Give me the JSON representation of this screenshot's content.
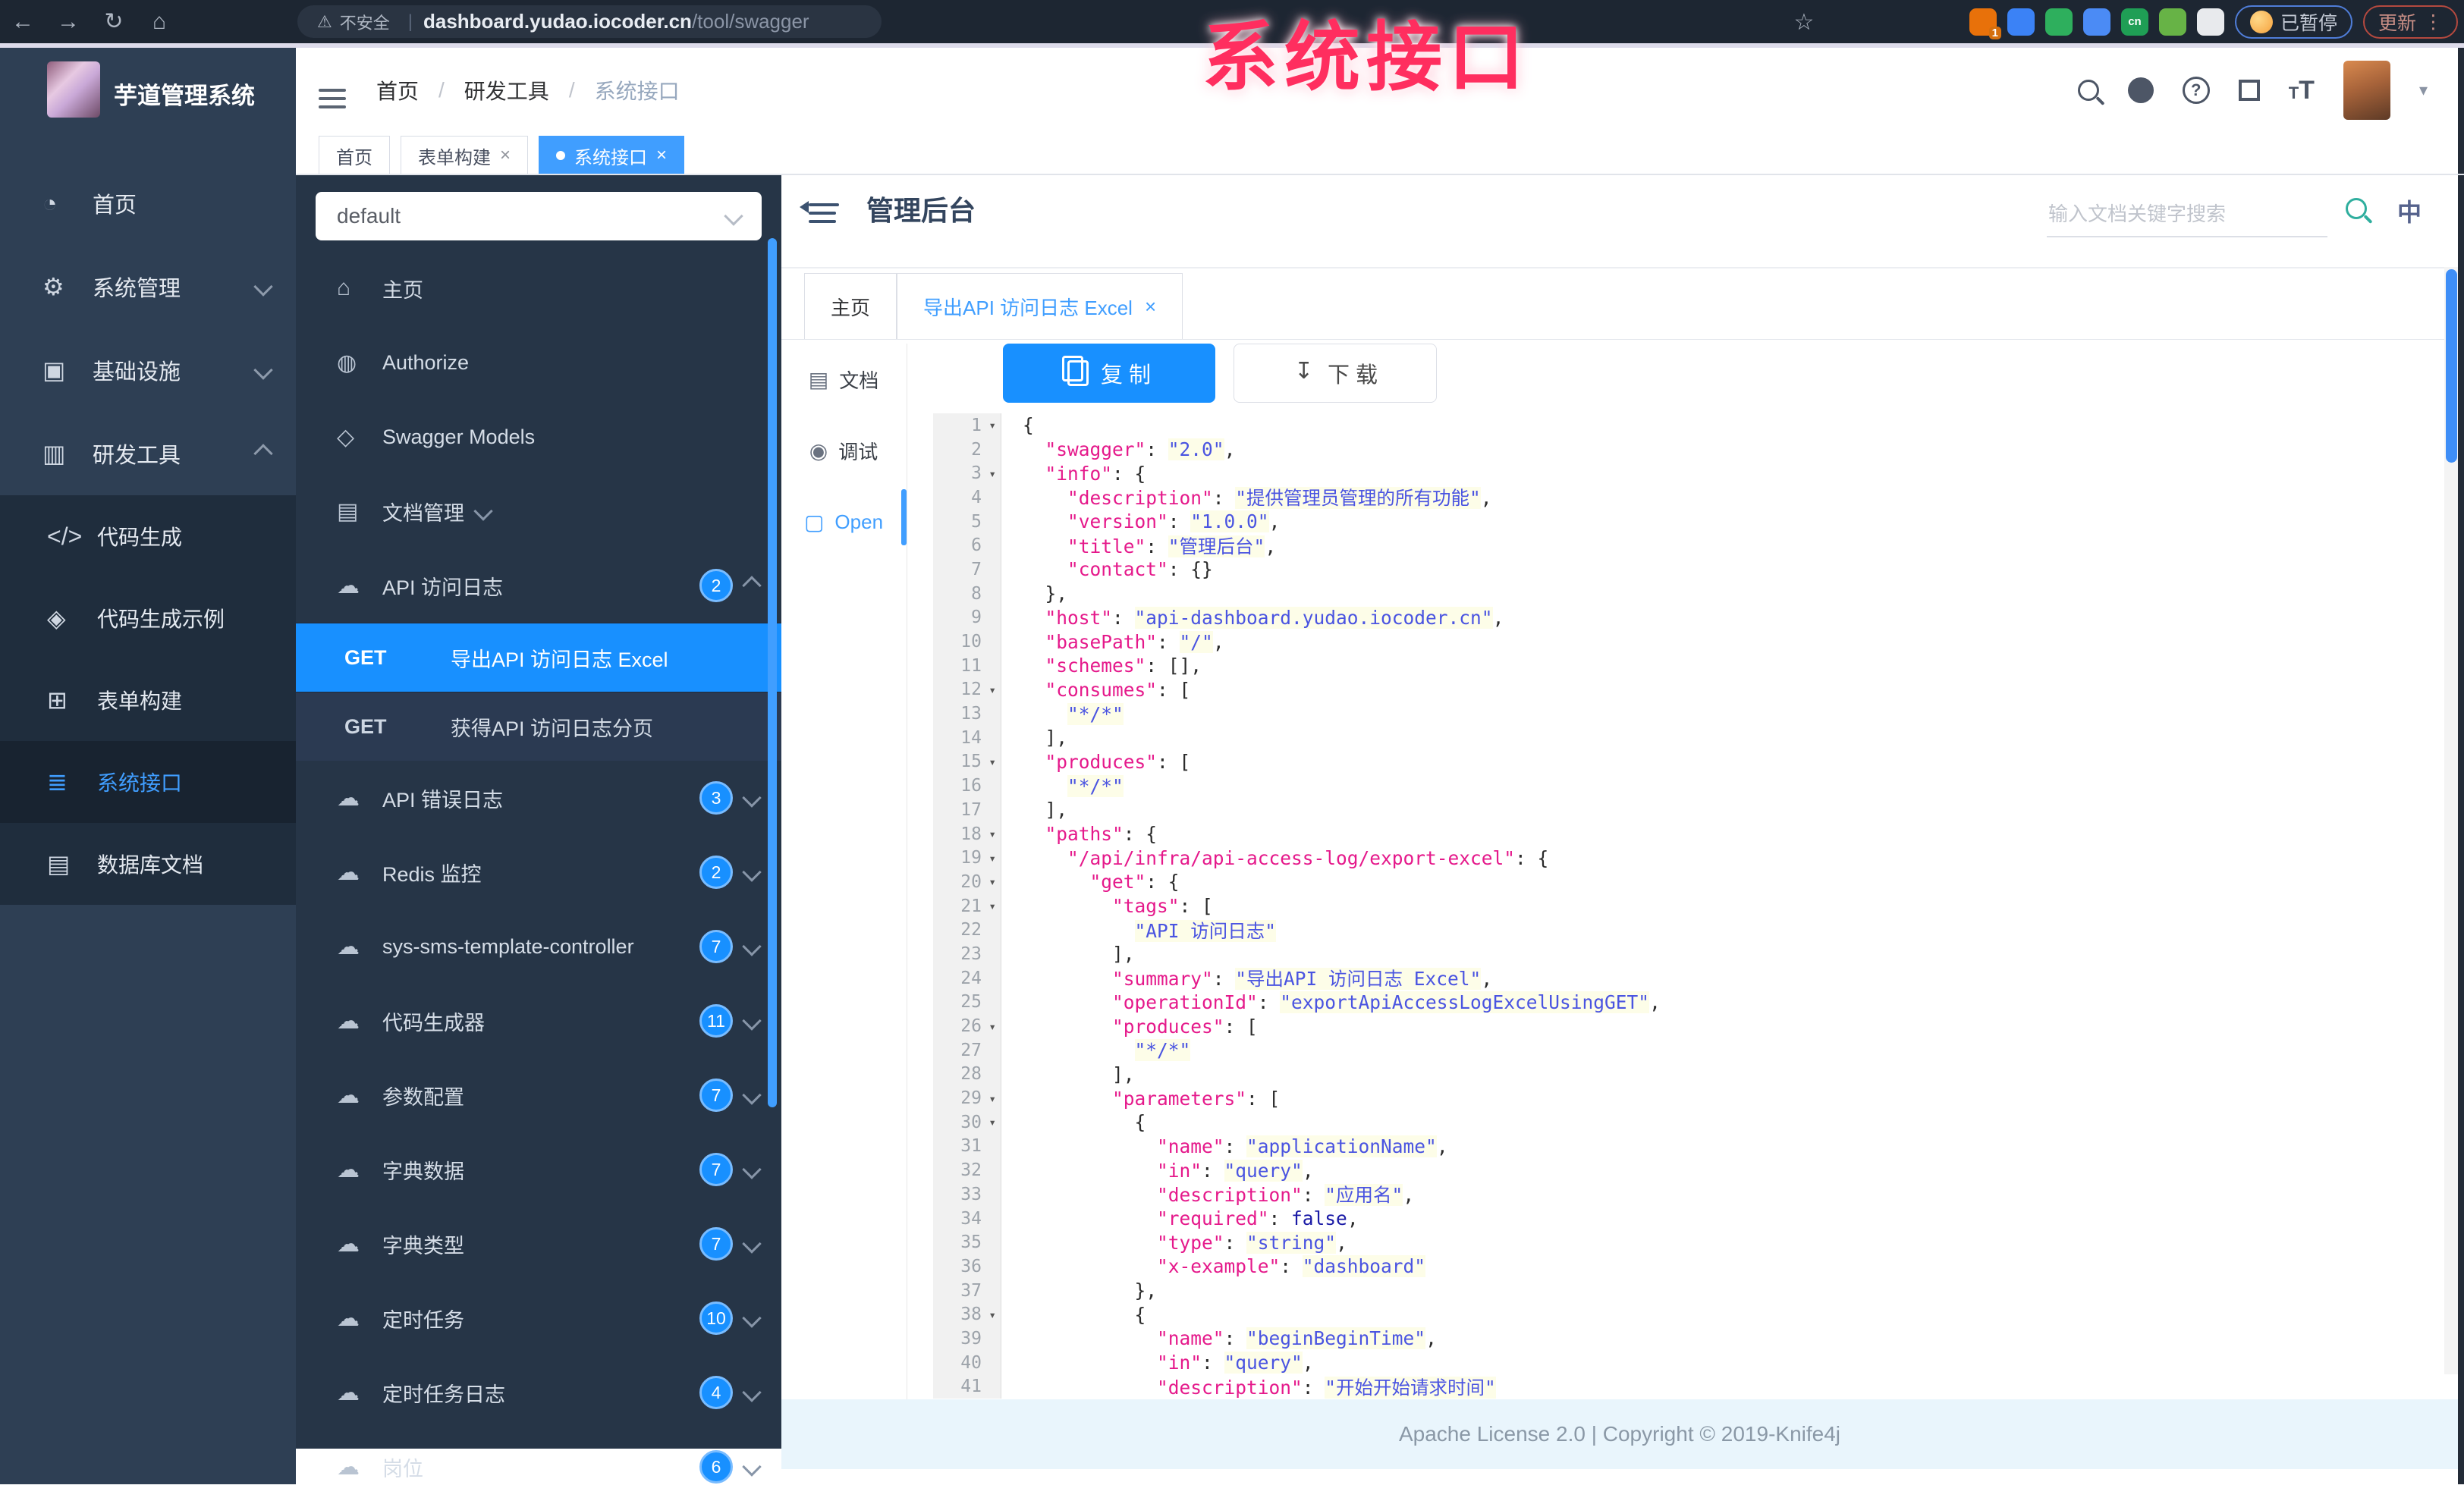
{
  "colors": {
    "accent": "#1890ff",
    "sidebar_bg": "#2e3f54",
    "submenu_bg": "#1f2d3d",
    "panel_bg": "#263547",
    "code_key": "#e5198b",
    "code_string": "#4a54e1",
    "code_bool": "#1a1aa6",
    "footer_bg": "#e9f5fc"
  },
  "annotation": {
    "text": "系统接口"
  },
  "browser": {
    "secure_label": "不安全",
    "url_host": "dashboard.yudao.iocoder.cn",
    "url_path": "/tool/swagger",
    "paused_label": "已暂停",
    "update_label": "更新",
    "extensions": [
      {
        "name": "extension-orange",
        "color": "#e8710a",
        "badge": "1"
      },
      {
        "name": "extension-drop",
        "color": "#3b82f6"
      },
      {
        "name": "extension-shield",
        "color": "#2eaf5d"
      },
      {
        "name": "extension-grid",
        "color": "#4b8bf5"
      },
      {
        "name": "extension-cn",
        "color": "#1f9e55",
        "label": "cn"
      },
      {
        "name": "extension-leaf",
        "color": "#67b346"
      },
      {
        "name": "extension-star",
        "color": "#e8eaed"
      }
    ]
  },
  "sidebar": {
    "logo_title": "芋道管理系统",
    "items": [
      {
        "label": "首页",
        "icon": "dashboard-icon",
        "glyph": "◔"
      },
      {
        "label": "系统管理",
        "icon": "gear-icon",
        "glyph": "⚙",
        "chevron": "down"
      },
      {
        "label": "基础设施",
        "icon": "monitor-icon",
        "glyph": "▣",
        "chevron": "down"
      },
      {
        "label": "研发工具",
        "icon": "toolbox-icon",
        "glyph": "▥",
        "chevron": "up"
      }
    ],
    "submenu": [
      {
        "label": "代码生成",
        "icon": "code-icon",
        "glyph": "</>"
      },
      {
        "label": "代码生成示例",
        "icon": "shield-icon",
        "glyph": "◈"
      },
      {
        "label": "表单构建",
        "icon": "form-icon",
        "glyph": "⊞"
      },
      {
        "label": "系统接口",
        "icon": "api-icon",
        "glyph": "≣",
        "active": true
      },
      {
        "label": "数据库文档",
        "icon": "database-icon",
        "glyph": "▤"
      }
    ]
  },
  "header": {
    "breadcrumb": [
      "首页",
      "研发工具",
      "系统接口"
    ],
    "tags": [
      {
        "label": "首页"
      },
      {
        "label": "表单构建",
        "closable": true
      },
      {
        "label": "系统接口",
        "closable": true,
        "active": true
      }
    ]
  },
  "api_panel": {
    "group_select": "default",
    "menus": [
      {
        "label": "主页",
        "icon": "home-icon",
        "glyph": "⌂"
      },
      {
        "label": "Authorize",
        "icon": "lock-icon",
        "glyph": "◍"
      },
      {
        "label": "Swagger Models",
        "icon": "models-icon",
        "glyph": "◇"
      },
      {
        "label": "文档管理",
        "icon": "doc-manage-icon",
        "glyph": "▤",
        "chevron": "down"
      },
      {
        "label": "API 访问日志",
        "icon": "cloud-icon",
        "glyph": "☁",
        "badge": "2",
        "chevron": "up"
      }
    ],
    "operations": [
      {
        "method": "GET",
        "label": "导出API 访问日志 Excel",
        "selected": true
      },
      {
        "method": "GET",
        "label": "获得API 访问日志分页"
      }
    ],
    "menus2": [
      {
        "label": "API 错误日志",
        "icon": "cloud-icon",
        "glyph": "☁",
        "badge": "3",
        "chevron": "down"
      },
      {
        "label": "Redis 监控",
        "icon": "cloud-icon",
        "glyph": "☁",
        "badge": "2",
        "chevron": "down"
      },
      {
        "label": "sys-sms-template-controller",
        "icon": "cloud-icon",
        "glyph": "☁",
        "badge": "7",
        "chevron": "down"
      },
      {
        "label": "代码生成器",
        "icon": "cloud-icon",
        "glyph": "☁",
        "badge": "11",
        "chevron": "down"
      },
      {
        "label": "参数配置",
        "icon": "cloud-icon",
        "glyph": "☁",
        "badge": "7",
        "chevron": "down"
      },
      {
        "label": "字典数据",
        "icon": "cloud-icon",
        "glyph": "☁",
        "badge": "7",
        "chevron": "down"
      },
      {
        "label": "字典类型",
        "icon": "cloud-icon",
        "glyph": "☁",
        "badge": "7",
        "chevron": "down"
      },
      {
        "label": "定时任务",
        "icon": "cloud-icon",
        "glyph": "☁",
        "badge": "10",
        "chevron": "down"
      },
      {
        "label": "定时任务日志",
        "icon": "cloud-icon",
        "glyph": "☁",
        "badge": "4",
        "chevron": "down"
      },
      {
        "label": "岗位",
        "icon": "cloud-icon",
        "glyph": "☁",
        "badge": "6",
        "chevron": "down"
      }
    ]
  },
  "content": {
    "title": "管理后台",
    "search_placeholder": "输入文档关键字搜索",
    "lang_icon_label": "中",
    "doc_tabs": [
      {
        "label": "主页"
      },
      {
        "label": "导出API 访问日志 Excel",
        "closable": true,
        "active": true
      }
    ],
    "menu": [
      {
        "label": "文档",
        "icon": "doc-icon",
        "glyph": "▤"
      },
      {
        "label": "调试",
        "icon": "debug-icon",
        "glyph": "◉"
      },
      {
        "label": "Open",
        "icon": "file-icon",
        "glyph": "▢",
        "active": true
      }
    ],
    "copy_label": "复 制",
    "download_label": "下 载",
    "footer": "Apache License 2.0 | Copyright © 2019-Knife4j"
  },
  "code": {
    "lines": [
      {
        "n": 1,
        "f": 1,
        "i": 0,
        "t": [
          [
            "p",
            "{"
          ]
        ]
      },
      {
        "n": 2,
        "i": 2,
        "t": [
          [
            "k",
            "\"swagger\""
          ],
          [
            "p",
            ": "
          ],
          [
            "s",
            "\"2.0\""
          ],
          [
            "p",
            ","
          ]
        ]
      },
      {
        "n": 3,
        "f": 1,
        "i": 2,
        "t": [
          [
            "k",
            "\"info\""
          ],
          [
            "p",
            ": {"
          ]
        ]
      },
      {
        "n": 4,
        "i": 4,
        "t": [
          [
            "k",
            "\"description\""
          ],
          [
            "p",
            ": "
          ],
          [
            "s",
            "\"提供管理员管理的所有功能\""
          ],
          [
            "p",
            ","
          ]
        ]
      },
      {
        "n": 5,
        "i": 4,
        "t": [
          [
            "k",
            "\"version\""
          ],
          [
            "p",
            ": "
          ],
          [
            "s",
            "\"1.0.0\""
          ],
          [
            "p",
            ","
          ]
        ]
      },
      {
        "n": 6,
        "i": 4,
        "t": [
          [
            "k",
            "\"title\""
          ],
          [
            "p",
            ": "
          ],
          [
            "s",
            "\"管理后台\""
          ],
          [
            "p",
            ","
          ]
        ]
      },
      {
        "n": 7,
        "i": 4,
        "t": [
          [
            "k",
            "\"contact\""
          ],
          [
            "p",
            ": {}"
          ]
        ]
      },
      {
        "n": 8,
        "i": 2,
        "t": [
          [
            "p",
            "},"
          ]
        ]
      },
      {
        "n": 9,
        "i": 2,
        "t": [
          [
            "k",
            "\"host\""
          ],
          [
            "p",
            ": "
          ],
          [
            "s",
            "\"api-dashboard.yudao.iocoder.cn\""
          ],
          [
            "p",
            ","
          ]
        ]
      },
      {
        "n": 10,
        "i": 2,
        "t": [
          [
            "k",
            "\"basePath\""
          ],
          [
            "p",
            ": "
          ],
          [
            "s",
            "\"/\""
          ],
          [
            "p",
            ","
          ]
        ]
      },
      {
        "n": 11,
        "i": 2,
        "t": [
          [
            "k",
            "\"schemes\""
          ],
          [
            "p",
            ": [],"
          ]
        ]
      },
      {
        "n": 12,
        "f": 1,
        "i": 2,
        "t": [
          [
            "k",
            "\"consumes\""
          ],
          [
            "p",
            ": ["
          ]
        ]
      },
      {
        "n": 13,
        "i": 4,
        "t": [
          [
            "s",
            "\"*/*\""
          ]
        ]
      },
      {
        "n": 14,
        "i": 2,
        "t": [
          [
            "p",
            "],"
          ]
        ]
      },
      {
        "n": 15,
        "f": 1,
        "i": 2,
        "t": [
          [
            "k",
            "\"produces\""
          ],
          [
            "p",
            ": ["
          ]
        ]
      },
      {
        "n": 16,
        "i": 4,
        "t": [
          [
            "s",
            "\"*/*\""
          ]
        ]
      },
      {
        "n": 17,
        "i": 2,
        "t": [
          [
            "p",
            "],"
          ]
        ]
      },
      {
        "n": 18,
        "f": 1,
        "i": 2,
        "t": [
          [
            "k",
            "\"paths\""
          ],
          [
            "p",
            ": {"
          ]
        ]
      },
      {
        "n": 19,
        "f": 1,
        "i": 4,
        "t": [
          [
            "k",
            "\"/api/infra/api-access-log/export-excel\""
          ],
          [
            "p",
            ": {"
          ]
        ]
      },
      {
        "n": 20,
        "f": 1,
        "i": 6,
        "t": [
          [
            "k",
            "\"get\""
          ],
          [
            "p",
            ": {"
          ]
        ]
      },
      {
        "n": 21,
        "f": 1,
        "i": 8,
        "t": [
          [
            "k",
            "\"tags\""
          ],
          [
            "p",
            ": ["
          ]
        ]
      },
      {
        "n": 22,
        "i": 10,
        "t": [
          [
            "s",
            "\"API 访问日志\""
          ]
        ]
      },
      {
        "n": 23,
        "i": 8,
        "t": [
          [
            "p",
            "],"
          ]
        ]
      },
      {
        "n": 24,
        "i": 8,
        "t": [
          [
            "k",
            "\"summary\""
          ],
          [
            "p",
            ": "
          ],
          [
            "s",
            "\"导出API 访问日志 Excel\""
          ],
          [
            "p",
            ","
          ]
        ]
      },
      {
        "n": 25,
        "i": 8,
        "t": [
          [
            "k",
            "\"operationId\""
          ],
          [
            "p",
            ": "
          ],
          [
            "s",
            "\"exportApiAccessLogExcelUsingGET\""
          ],
          [
            "p",
            ","
          ]
        ]
      },
      {
        "n": 26,
        "f": 1,
        "i": 8,
        "t": [
          [
            "k",
            "\"produces\""
          ],
          [
            "p",
            ": ["
          ]
        ]
      },
      {
        "n": 27,
        "i": 10,
        "t": [
          [
            "s",
            "\"*/*\""
          ]
        ]
      },
      {
        "n": 28,
        "i": 8,
        "t": [
          [
            "p",
            "],"
          ]
        ]
      },
      {
        "n": 29,
        "f": 1,
        "i": 8,
        "t": [
          [
            "k",
            "\"parameters\""
          ],
          [
            "p",
            ": ["
          ]
        ]
      },
      {
        "n": 30,
        "f": 1,
        "i": 10,
        "t": [
          [
            "p",
            "{"
          ]
        ]
      },
      {
        "n": 31,
        "i": 12,
        "t": [
          [
            "k",
            "\"name\""
          ],
          [
            "p",
            ": "
          ],
          [
            "s",
            "\"applicationName\""
          ],
          [
            "p",
            ","
          ]
        ]
      },
      {
        "n": 32,
        "i": 12,
        "t": [
          [
            "k",
            "\"in\""
          ],
          [
            "p",
            ": "
          ],
          [
            "s",
            "\"query\""
          ],
          [
            "p",
            ","
          ]
        ]
      },
      {
        "n": 33,
        "i": 12,
        "t": [
          [
            "k",
            "\"description\""
          ],
          [
            "p",
            ": "
          ],
          [
            "s",
            "\"应用名\""
          ],
          [
            "p",
            ","
          ]
        ]
      },
      {
        "n": 34,
        "i": 12,
        "t": [
          [
            "k",
            "\"required\""
          ],
          [
            "p",
            ": "
          ],
          [
            "b",
            "false"
          ],
          [
            "p",
            ","
          ]
        ]
      },
      {
        "n": 35,
        "i": 12,
        "t": [
          [
            "k",
            "\"type\""
          ],
          [
            "p",
            ": "
          ],
          [
            "s",
            "\"string\""
          ],
          [
            "p",
            ","
          ]
        ]
      },
      {
        "n": 36,
        "i": 12,
        "t": [
          [
            "k",
            "\"x-example\""
          ],
          [
            "p",
            ": "
          ],
          [
            "s",
            "\"dashboard\""
          ]
        ]
      },
      {
        "n": 37,
        "i": 10,
        "t": [
          [
            "p",
            "},"
          ]
        ]
      },
      {
        "n": 38,
        "f": 1,
        "i": 10,
        "t": [
          [
            "p",
            "{"
          ]
        ]
      },
      {
        "n": 39,
        "i": 12,
        "t": [
          [
            "k",
            "\"name\""
          ],
          [
            "p",
            ": "
          ],
          [
            "s",
            "\"beginBeginTime\""
          ],
          [
            "p",
            ","
          ]
        ]
      },
      {
        "n": 40,
        "i": 12,
        "t": [
          [
            "k",
            "\"in\""
          ],
          [
            "p",
            ": "
          ],
          [
            "s",
            "\"query\""
          ],
          [
            "p",
            ","
          ]
        ]
      },
      {
        "n": 41,
        "i": 12,
        "t": [
          [
            "k",
            "\"description\""
          ],
          [
            "p",
            ": "
          ],
          [
            "s",
            "\"开始开始请求时间\""
          ]
        ]
      }
    ]
  }
}
